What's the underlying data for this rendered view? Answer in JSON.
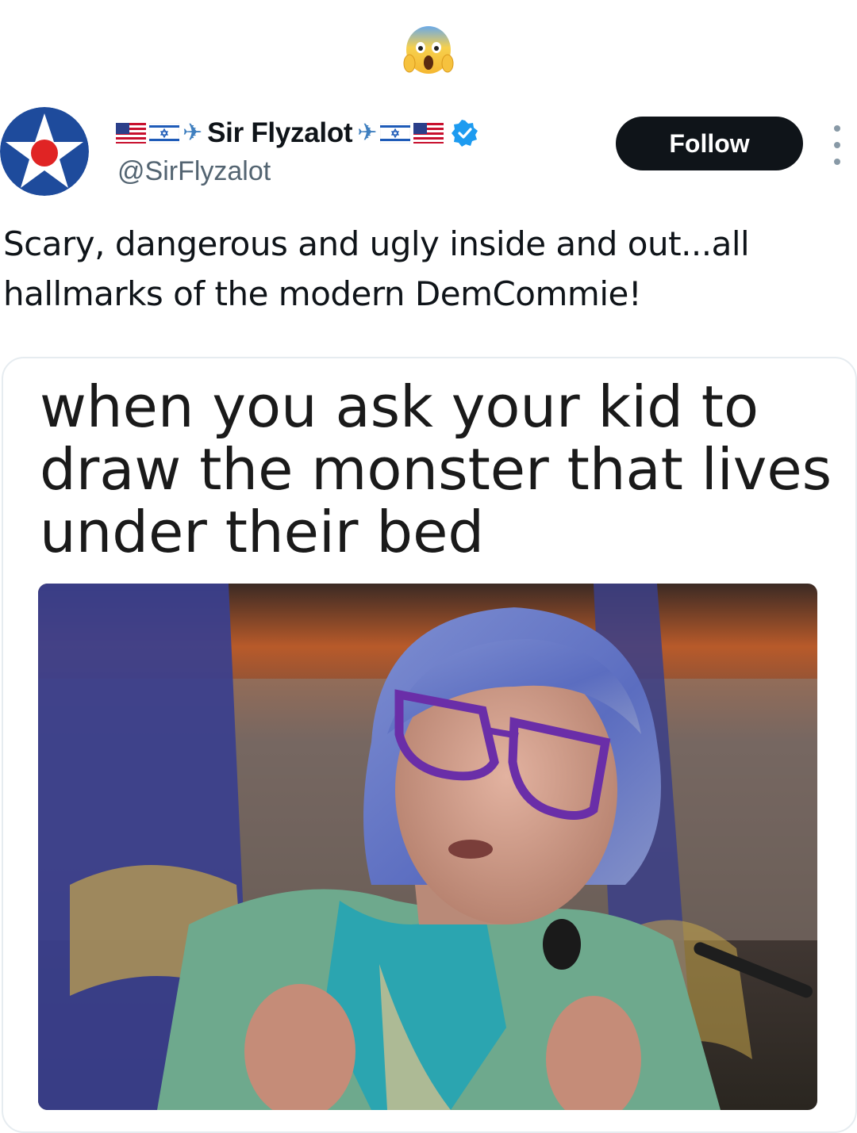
{
  "header": {
    "emoji_icon": "face-screaming-in-fear-icon"
  },
  "author": {
    "display_name": "Sir Flyzalot",
    "handle": "@SirFlyzalot",
    "avatar_icon": "star-roundel-icon",
    "verified_icon": "verified-badge-icon",
    "name_decorations": [
      "us-flag-icon",
      "israel-flag-icon",
      "airplane-icon"
    ]
  },
  "actions": {
    "follow_label": "Follow",
    "more_icon": "more-options-icon"
  },
  "tweet": {
    "text": "Scary, dangerous and ugly inside and out...all hallmarks of the modern DemCommie!"
  },
  "media": {
    "caption": "when you ask your kid to draw the monster that lives under their bed"
  },
  "colors": {
    "follow_bg": "#0f1419",
    "handle": "#536471",
    "verified": "#1d9bf0",
    "accent_blue": "#1e4b9c",
    "roundel_red": "#e02424"
  }
}
